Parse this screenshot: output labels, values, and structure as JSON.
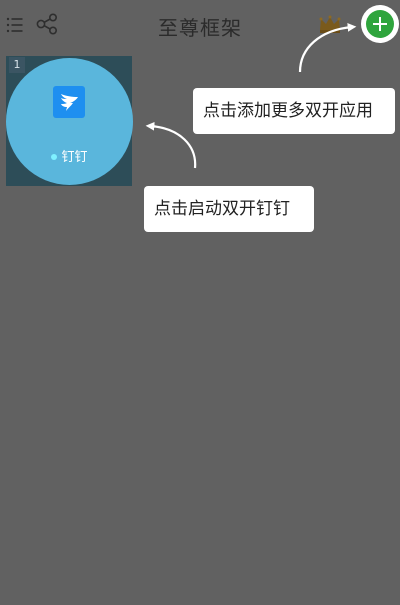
{
  "header": {
    "title": "至尊框架",
    "icons": {
      "menu": "list-menu-icon",
      "share": "share-icon",
      "vip": "crown-icon",
      "add": "plus-icon"
    }
  },
  "slots": [
    {
      "number": "1",
      "app_name": "钉钉",
      "app_icon": "dingtalk-icon",
      "running_indicator_color": "#7ff0ff"
    }
  ],
  "tips": {
    "add_more": "点击添加更多双开应用",
    "launch": "点击启动双开钉钉"
  },
  "colors": {
    "overlay_background": "#616161",
    "slot_background": "#2d4d58",
    "app_circle": "#5ab6dc",
    "add_button": "#2fa53d",
    "dingtalk_blue": "#1e8ff0"
  }
}
